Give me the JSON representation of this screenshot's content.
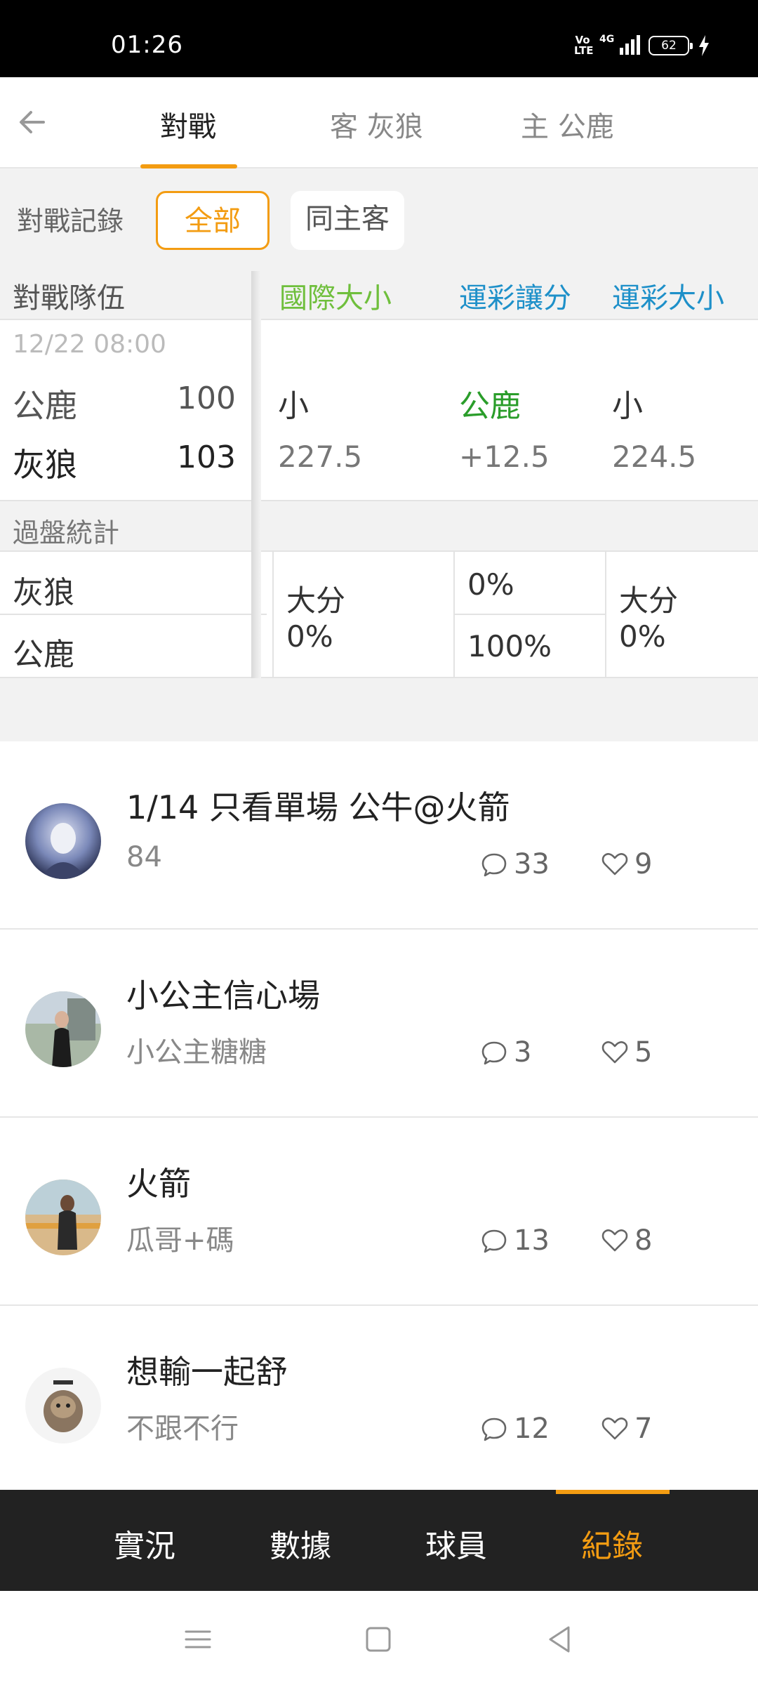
{
  "status_bar": {
    "time": "01:26",
    "volte": "Vo\nLTE",
    "network": "4G",
    "battery": "62"
  },
  "top_nav": {
    "tabs": [
      {
        "label": "對戰",
        "active": true
      },
      {
        "label": "客 灰狼",
        "active": false
      },
      {
        "label": "主 公鹿",
        "active": false
      }
    ]
  },
  "filter": {
    "label": "對戰記錄",
    "options": [
      "全部",
      "同主客"
    ],
    "selected": "全部"
  },
  "table_header": {
    "team_col": "對戰隊伍",
    "col1": "國際大小",
    "col2": "運彩讓分",
    "col3": "運彩大小"
  },
  "match": {
    "date": "12/22 08:00",
    "home_team": "公鹿",
    "home_score": "100",
    "away_team": "灰狼",
    "away_score": "103",
    "intl_result": "小",
    "intl_line": "227.5",
    "spread_result": "公鹿",
    "spread_line": "+12.5",
    "size_result": "小",
    "size_line": "224.5"
  },
  "stats": {
    "title": "過盤統計",
    "team1": "灰狼",
    "team2": "公鹿",
    "intl_label": "大分",
    "intl_pct": "0%",
    "spread_pct_team1": "0%",
    "spread_pct_team2": "100%",
    "size_label": "大分",
    "size_pct": "0%"
  },
  "posts": [
    {
      "title": "1/14 只看單場 公牛@火箭",
      "subtitle": "84",
      "comments": "33",
      "likes": "9"
    },
    {
      "title": "小公主信心場",
      "subtitle": "小公主糖糖",
      "comments": "3",
      "likes": "5"
    },
    {
      "title": "火箭",
      "subtitle": "瓜哥+碼",
      "comments": "13",
      "likes": "8"
    },
    {
      "title": "想輸一起舒",
      "subtitle": "不跟不行",
      "comments": "12",
      "likes": "7"
    }
  ],
  "bottom_tabs": [
    {
      "label": "實況",
      "active": false
    },
    {
      "label": "數據",
      "active": false
    },
    {
      "label": "球員",
      "active": false
    },
    {
      "label": "紀錄",
      "active": true
    }
  ],
  "colors": {
    "accent": "#f39c12",
    "intl_header": "#6fbf3c",
    "blue_header": "#1e90c9",
    "spread_team": "#2a9d2a"
  }
}
